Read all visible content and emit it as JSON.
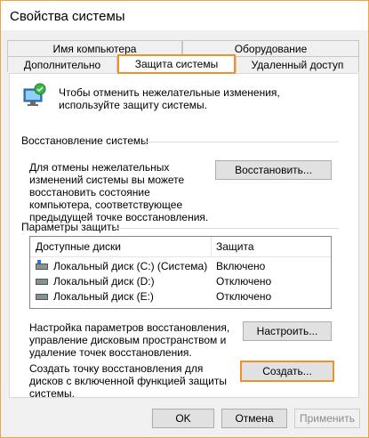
{
  "window": {
    "title": "Свойства системы"
  },
  "tabs": {
    "row1": [
      "Имя компьютера",
      "Оборудование"
    ],
    "row2": [
      "Дополнительно",
      "Защита системы",
      "Удаленный доступ"
    ]
  },
  "intro": "Чтобы отменить нежелательные изменения, используйте защиту системы.",
  "restore": {
    "group_title": "Восстановление системы",
    "text": "Для отмены нежелательных изменений системы вы можете восстановить состояние компьютера, соответствующее предыдущей точке восстановления.",
    "button": "Восстановить..."
  },
  "protection": {
    "group_title": "Параметры защиты",
    "columns": [
      "Доступные диски",
      "Защита"
    ],
    "rows": [
      {
        "drive": "Локальный диск (C:) (Система)",
        "status": "Включено",
        "icon": "system-drive-icon"
      },
      {
        "drive": "Локальный диск (D:)",
        "status": "Отключено",
        "icon": "drive-icon"
      },
      {
        "drive": "Локальный диск (E:)",
        "status": "Отключено",
        "icon": "drive-icon"
      }
    ],
    "configure_text": "Настройка параметров восстановления, управление дисковым пространством и удаление точек восстановления.",
    "configure_button": "Настроить...",
    "create_text": "Создать точку восстановления для дисков с включенной функцией защиты системы.",
    "create_button": "Создать..."
  },
  "footer": {
    "ok": "OK",
    "cancel": "Отмена",
    "apply": "Применить"
  },
  "colors": {
    "highlight": "#f0902a",
    "window_border": "#e8a541"
  }
}
